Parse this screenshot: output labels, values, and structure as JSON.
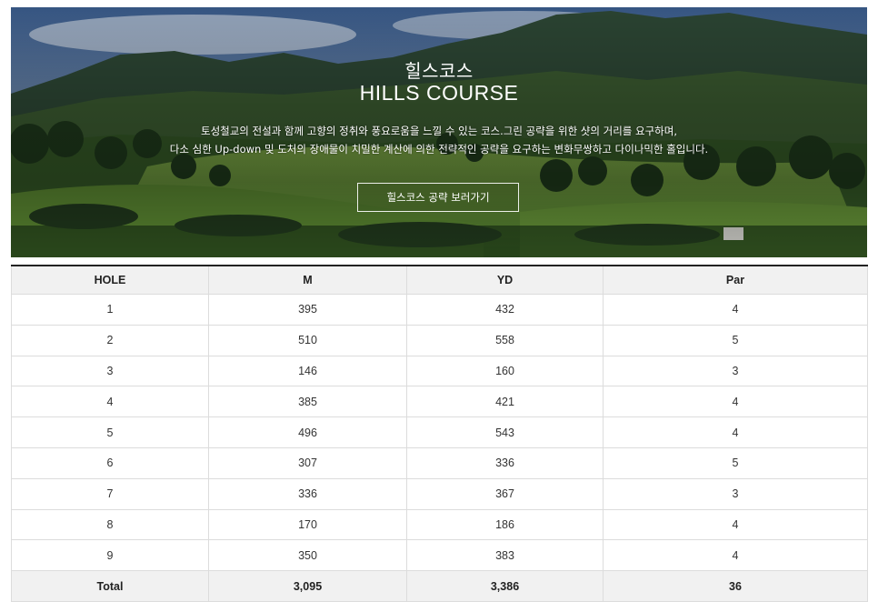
{
  "hero": {
    "title_ko": "힐스코스",
    "title_en": "HILLS COURSE",
    "desc_line1": "토성철교의 전설과 함께 고향의 정취와 풍요로움을 느낄 수 있는 코스.그린 공략을 위한 샷의 거리를 요구하며,",
    "desc_line2": "다소 심한 Up-down 및 도처의 장애물이 치밀한 계산에 의한 전략적인 공략을 요구하는 변화무쌍하고 다이나믹한 홀입니다.",
    "button_label": "힐스코스 공략 보러가기"
  },
  "table": {
    "headers": [
      "HOLE",
      "M",
      "YD",
      "Par"
    ],
    "rows": [
      [
        "1",
        "395",
        "432",
        "4"
      ],
      [
        "2",
        "510",
        "558",
        "5"
      ],
      [
        "3",
        "146",
        "160",
        "3"
      ],
      [
        "4",
        "385",
        "421",
        "4"
      ],
      [
        "5",
        "496",
        "543",
        "4"
      ],
      [
        "6",
        "307",
        "336",
        "5"
      ],
      [
        "7",
        "336",
        "367",
        "3"
      ],
      [
        "8",
        "170",
        "186",
        "4"
      ],
      [
        "9",
        "350",
        "383",
        "4"
      ]
    ],
    "total": [
      "Total",
      "3,095",
      "3,386",
      "36"
    ]
  },
  "colors": {
    "header_bg": "#f1f1f1",
    "border": "#dcdcdc",
    "top_rule": "#222222"
  }
}
